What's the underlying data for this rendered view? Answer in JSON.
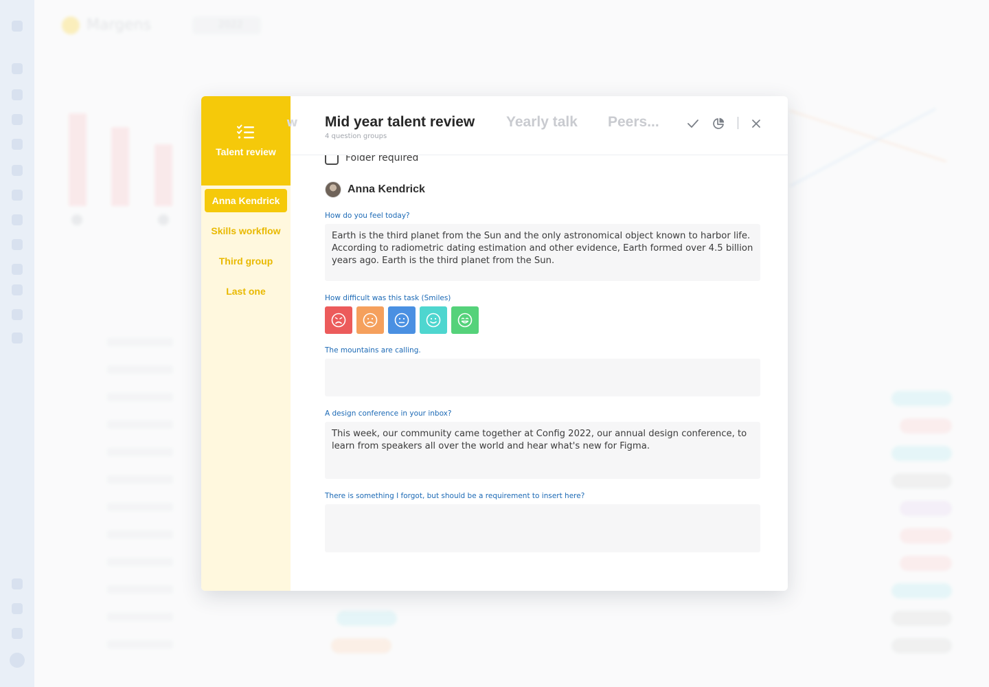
{
  "background": {
    "title": "Margens",
    "year": "2022",
    "colors": {
      "sidebar": "#dde7f3",
      "bar": "#f6c9cb"
    }
  },
  "modal": {
    "sidebar": {
      "header_label": "Talent review",
      "header_icon": "checklist-icon",
      "items": [
        {
          "label": "Anna Kendrick",
          "active": true
        },
        {
          "label": "Skills workflow",
          "active": false
        },
        {
          "label": "Third group",
          "active": false
        },
        {
          "label": "Last one",
          "active": false
        }
      ]
    },
    "header": {
      "ghost_tab": "w",
      "tabs": [
        {
          "label": "Mid year talent review",
          "active": true
        },
        {
          "label": "Yearly talk",
          "active": false
        },
        {
          "label": "Peers...",
          "active": false
        }
      ],
      "subtitle": "4 question groups",
      "actions": [
        "check-icon",
        "pie-chart-icon",
        "close-icon"
      ]
    },
    "content": {
      "folder_label": "Folder required",
      "person_name": "Anna Kendrick",
      "questions": [
        {
          "label": "How do you feel today?",
          "answer": "Earth is the third planet from the Sun and the only astronomical object known to harbor life. According to radiometric dating estimation and other evidence, Earth formed over 4.5 billion years ago. Earth is the third planet from the Sun."
        },
        {
          "label": "How difficult was this task (Smiles)"
        },
        {
          "label": "The mountains are calling.",
          "answer": ""
        },
        {
          "label": "A design conference in your inbox?",
          "answer": "This week, our community came together at Config 2022, our annual design conference, to learn from speakers all over the world and hear what's new for Figma."
        },
        {
          "label": "There is something I forgot, but should be a requirement to insert here?",
          "answer": ""
        }
      ],
      "smiles": [
        {
          "icon": "angry-face-icon",
          "color": "#ec5b5b"
        },
        {
          "icon": "sad-face-icon",
          "color": "#f5a05d"
        },
        {
          "icon": "neutral-face-icon",
          "color": "#4a90e2"
        },
        {
          "icon": "smile-face-icon",
          "color": "#4ed6cf"
        },
        {
          "icon": "happy-face-icon",
          "color": "#55d27a"
        }
      ]
    },
    "accent": "#f5c90a"
  }
}
